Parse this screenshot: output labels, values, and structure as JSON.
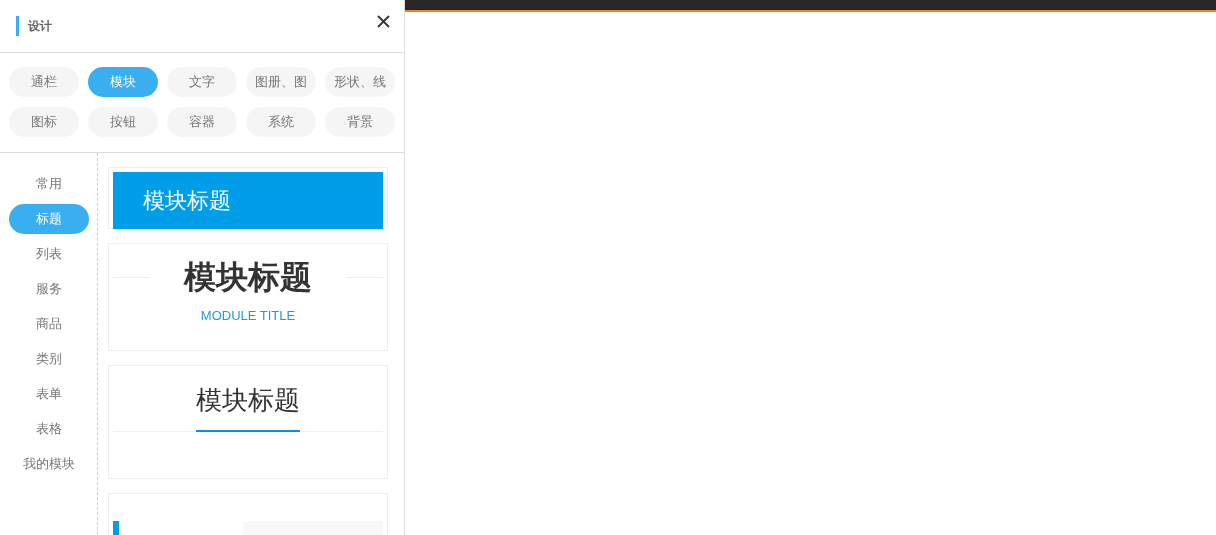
{
  "panel": {
    "title": "设计"
  },
  "categories": [
    {
      "label": "通栏",
      "selected": false
    },
    {
      "label": "模块",
      "selected": true
    },
    {
      "label": "文字",
      "selected": false
    },
    {
      "label": "图册、图",
      "selected": false
    },
    {
      "label": "形状、线",
      "selected": false
    },
    {
      "label": "图标",
      "selected": false
    },
    {
      "label": "按钮",
      "selected": false
    },
    {
      "label": "容器",
      "selected": false
    },
    {
      "label": "系统",
      "selected": false
    },
    {
      "label": "背景",
      "selected": false
    }
  ],
  "sidebar": {
    "items": [
      {
        "label": "常用",
        "selected": false
      },
      {
        "label": "标题",
        "selected": true
      },
      {
        "label": "列表",
        "selected": false
      },
      {
        "label": "服务",
        "selected": false
      },
      {
        "label": "商品",
        "selected": false
      },
      {
        "label": "类别",
        "selected": false
      },
      {
        "label": "表单",
        "selected": false
      },
      {
        "label": "表格",
        "selected": false
      },
      {
        "label": "我的模块",
        "selected": false
      }
    ]
  },
  "templates": [
    {
      "kind": "banner",
      "title": "模块标题"
    },
    {
      "kind": "centered",
      "title": "模块标题",
      "subtitle": "MODULE TITLE"
    },
    {
      "kind": "underlined",
      "title": "模块标题"
    },
    {
      "kind": "sidebar"
    }
  ]
}
